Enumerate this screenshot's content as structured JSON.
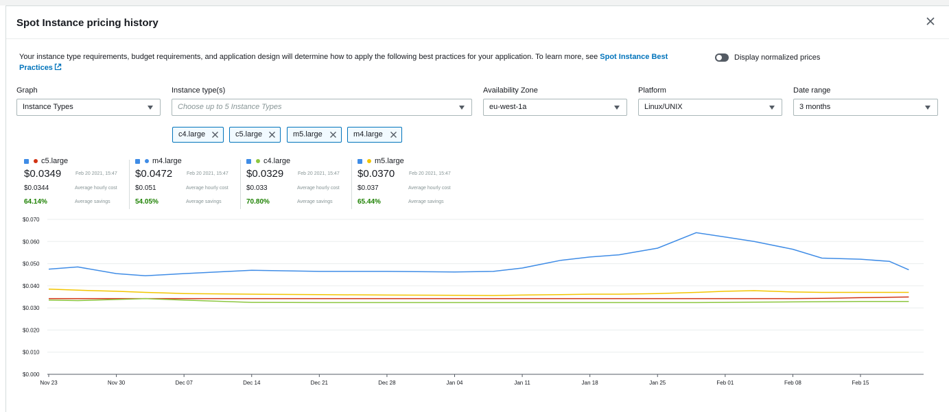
{
  "modal": {
    "title": "Spot Instance pricing history",
    "description": "Your instance type requirements, budget requirements, and application design will determine how to apply the following best practices for your application. To learn more, see ",
    "link_text": "Spot Instance Best Practices",
    "toggle_label": "Display normalized prices"
  },
  "filters": {
    "graph": {
      "label": "Graph",
      "value": "Instance Types"
    },
    "instance_types": {
      "label": "Instance type(s)",
      "placeholder": "Choose up to 5 Instance Types"
    },
    "az": {
      "label": "Availability Zone",
      "value": "eu-west-1a"
    },
    "platform": {
      "label": "Platform",
      "value": "Linux/UNIX"
    },
    "date_range": {
      "label": "Date range",
      "value": "3 months"
    }
  },
  "tokens": [
    "c4.large",
    "c5.large",
    "m5.large",
    "m4.large"
  ],
  "legend": [
    {
      "name": "c5.large",
      "color": "#d13212",
      "price": "$0.0349",
      "timestamp": "Feb 20 2021, 15:47",
      "avg": "$0.0344",
      "avg_label": "Average hourly cost",
      "savings": "64.14%",
      "savings_label": "Average savings"
    },
    {
      "name": "m4.large",
      "color": "#3f8ce6",
      "price": "$0.0472",
      "timestamp": "Feb 20 2021, 15:47",
      "avg": "$0.051",
      "avg_label": "Average hourly cost",
      "savings": "54.05%",
      "savings_label": "Average savings"
    },
    {
      "name": "c4.large",
      "color": "#8cc63f",
      "price": "$0.0329",
      "timestamp": "Feb 20 2021, 15:47",
      "avg": "$0.033",
      "avg_label": "Average hourly cost",
      "savings": "70.80%",
      "savings_label": "Average savings"
    },
    {
      "name": "m5.large",
      "color": "#f2c500",
      "price": "$0.0370",
      "timestamp": "Feb 20 2021, 15:47",
      "avg": "$0.037",
      "avg_label": "Average hourly cost",
      "savings": "65.44%",
      "savings_label": "Average savings"
    }
  ],
  "chart_data": {
    "type": "line",
    "title": "",
    "xlabel": "",
    "ylabel": "",
    "ylim": [
      0,
      0.07
    ],
    "grid": true,
    "y_ticks": [
      "$0.000",
      "$0.010",
      "$0.020",
      "$0.030",
      "$0.040",
      "$0.050",
      "$0.060",
      "$0.070"
    ],
    "x_ticks": [
      "Nov 23",
      "Nov 30",
      "Dec 07",
      "Dec 14",
      "Dec 21",
      "Dec 28",
      "Jan 04",
      "Jan 11",
      "Jan 18",
      "Jan 25",
      "Feb 01",
      "Feb 08",
      "Feb 15"
    ],
    "x": [
      "2020-11-23",
      "2020-11-26",
      "2020-11-30",
      "2020-12-03",
      "2020-12-07",
      "2020-12-14",
      "2020-12-21",
      "2020-12-28",
      "2021-01-04",
      "2021-01-08",
      "2021-01-11",
      "2021-01-15",
      "2021-01-18",
      "2021-01-21",
      "2021-01-25",
      "2021-01-29",
      "2021-02-01",
      "2021-02-04",
      "2021-02-08",
      "2021-02-11",
      "2021-02-15",
      "2021-02-18",
      "2021-02-20"
    ],
    "series": [
      {
        "name": "m4.large",
        "color": "#3f8ce6",
        "values": [
          0.0475,
          0.0485,
          0.0455,
          0.0445,
          0.0455,
          0.047,
          0.0465,
          0.0465,
          0.0462,
          0.0465,
          0.048,
          0.0515,
          0.053,
          0.054,
          0.057,
          0.064,
          0.062,
          0.06,
          0.0565,
          0.0525,
          0.052,
          0.051,
          0.0472
        ]
      },
      {
        "name": "m5.large",
        "color": "#f2c500",
        "values": [
          0.0385,
          0.038,
          0.0375,
          0.037,
          0.0365,
          0.0362,
          0.036,
          0.0358,
          0.0357,
          0.0356,
          0.0358,
          0.036,
          0.0362,
          0.0362,
          0.0365,
          0.037,
          0.0375,
          0.0378,
          0.0372,
          0.037,
          0.037,
          0.037,
          0.037
        ]
      },
      {
        "name": "c5.large",
        "color": "#d13212",
        "values": [
          0.0342,
          0.0342,
          0.0342,
          0.0342,
          0.0342,
          0.0342,
          0.0342,
          0.0342,
          0.0342,
          0.0342,
          0.0342,
          0.0342,
          0.0342,
          0.0342,
          0.0342,
          0.0342,
          0.0342,
          0.0342,
          0.0342,
          0.0343,
          0.0346,
          0.0348,
          0.0349
        ]
      },
      {
        "name": "c4.large",
        "color": "#8cc63f",
        "values": [
          0.0335,
          0.0333,
          0.0338,
          0.0342,
          0.0335,
          0.0325,
          0.0324,
          0.0324,
          0.0324,
          0.0324,
          0.0324,
          0.0324,
          0.0324,
          0.0324,
          0.0324,
          0.0324,
          0.0325,
          0.0326,
          0.0327,
          0.0328,
          0.0329,
          0.0329,
          0.0329
        ]
      }
    ]
  }
}
